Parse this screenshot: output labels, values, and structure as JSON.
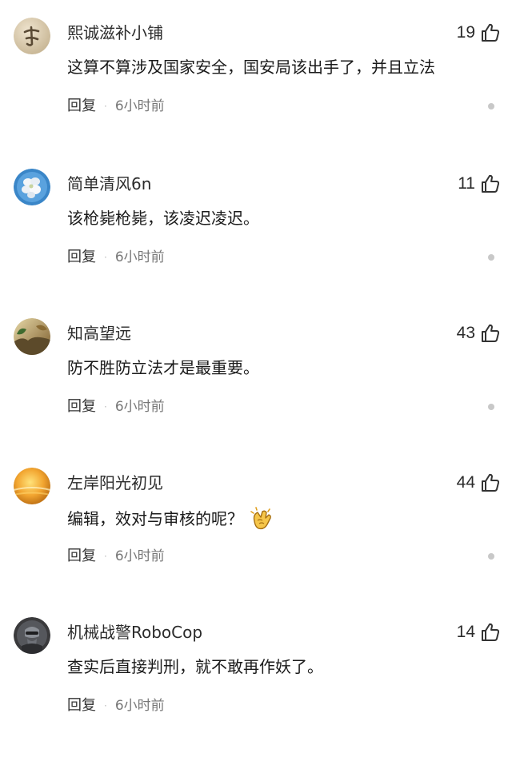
{
  "comments": [
    {
      "username": "熙诚滋补小铺",
      "likes": "19",
      "text": "这算不算涉及国家安全，国安局该出手了，并且立法",
      "reply_label": "回复",
      "separator": "·",
      "time": "6小时前",
      "avatar_icon": "brush-stroke-avatar",
      "like_icon": "thumbs-up-icon"
    },
    {
      "username": "简单清风6n",
      "likes": "11",
      "text": "该枪毙枪毙，该凌迟凌迟。",
      "reply_label": "回复",
      "separator": "·",
      "time": "6小时前",
      "avatar_icon": "white-flower-avatar",
      "like_icon": "thumbs-up-icon"
    },
    {
      "username": "知高望远",
      "likes": "43",
      "text": "防不胜防立法才是最重要。",
      "reply_label": "回复",
      "separator": "·",
      "time": "6小时前",
      "avatar_icon": "landscape-avatar",
      "like_icon": "thumbs-up-icon"
    },
    {
      "username": "左岸阳光初见",
      "likes": "44",
      "text": "编辑，效对与审核的呢？",
      "reply_label": "回复",
      "separator": "·",
      "time": "6小时前",
      "avatar_icon": "sunset-avatar",
      "like_icon": "thumbs-up-icon",
      "emoji_icon": "clapping-hands-emoji"
    },
    {
      "username": "机械战警RoboCop",
      "likes": "14",
      "text": "查实后直接判刑，就不敢再作妖了。",
      "reply_label": "回复",
      "separator": "·",
      "time": "6小时前",
      "avatar_icon": "robocop-avatar",
      "like_icon": "thumbs-up-icon"
    }
  ]
}
